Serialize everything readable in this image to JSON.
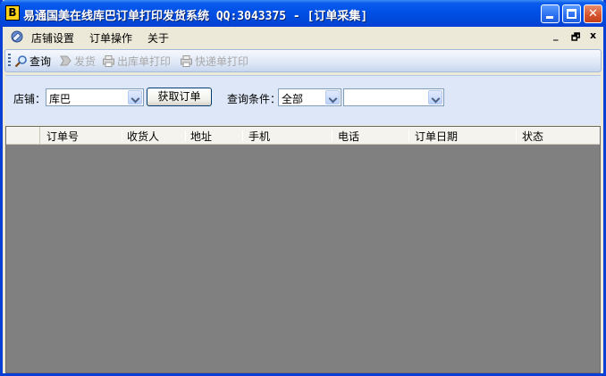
{
  "window": {
    "title": "易通国美在线库巴订单打印发货系统 QQ:3043375 - [订单采集]",
    "app_icon_glyph": "B",
    "controls": {
      "minimize": "minimize-icon",
      "maximize": "maximize-icon",
      "close": "close-icon"
    }
  },
  "menubar": {
    "items": [
      {
        "label": "店铺设置"
      },
      {
        "label": "订单操作"
      },
      {
        "label": "关于"
      }
    ],
    "mdi_minimize": "_",
    "mdi_restore": "🗗",
    "mdi_close": "x"
  },
  "toolbar": {
    "items": [
      {
        "label": "查询",
        "icon": "search-icon",
        "enabled": true
      },
      {
        "label": "发货",
        "icon": "ship-icon",
        "enabled": false
      },
      {
        "label": "出库单打印",
        "icon": "print-icon",
        "enabled": false
      },
      {
        "label": "快递单打印",
        "icon": "print-icon",
        "enabled": false
      }
    ]
  },
  "query": {
    "shop_label": "店铺：",
    "shop_value": "库巴",
    "fetch_button": "获取订单",
    "condition_label": "查询条件：",
    "condition_value": "全部",
    "condition_text": ""
  },
  "grid": {
    "columns": [
      "订单号",
      "收货人",
      "地址",
      "手机",
      "电话",
      "订单日期",
      "状态"
    ],
    "rows": []
  },
  "colors": {
    "titlebar": "#0050e6",
    "panel": "#dde7f7",
    "grid_bg": "#808080",
    "window_bg": "#ece9d8"
  }
}
